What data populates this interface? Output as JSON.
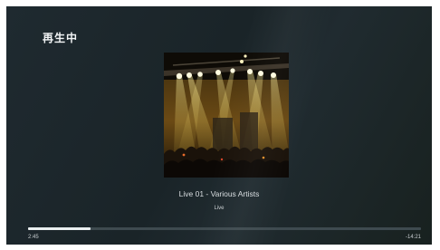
{
  "header": {
    "title": "再生中"
  },
  "now_playing": {
    "track_line": "Live 01  -  Various Artists",
    "album": "Live",
    "artwork": "concert-stage-lights"
  },
  "playback": {
    "elapsed": "2:45",
    "remaining": "-14:21",
    "progress_fraction": 0.16
  },
  "colors": {
    "background": "#1c262b",
    "accent": "#e9eeef",
    "track_bg": "#3e4a4f"
  }
}
